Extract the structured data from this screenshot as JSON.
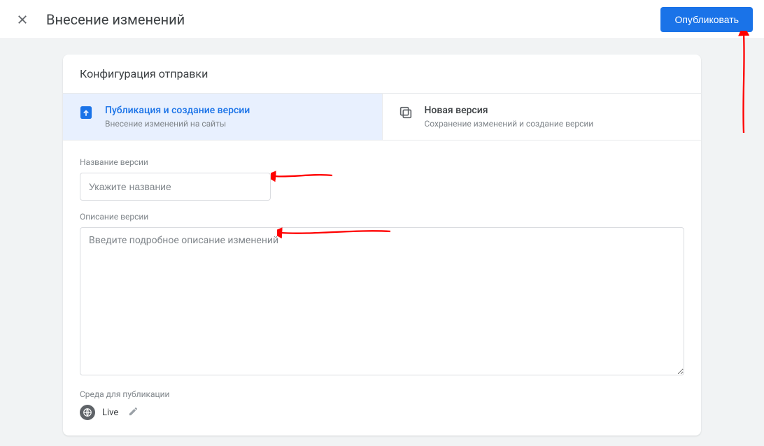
{
  "topbar": {
    "title": "Внесение изменений",
    "publish_label": "Опубликовать"
  },
  "card": {
    "header": "Конфигурация отправки",
    "options": [
      {
        "title": "Публикация и создание версии",
        "subtitle": "Внесение изменений на сайты",
        "selected": true,
        "icon": "upload-icon"
      },
      {
        "title": "Новая версия",
        "subtitle": "Сохранение изменений и создание версии",
        "selected": false,
        "icon": "copy-icon"
      }
    ],
    "version_name_label": "Название версии",
    "version_name_placeholder": "Укажите название",
    "version_desc_label": "Описание версии",
    "version_desc_placeholder": "Введите подробное описание изменений",
    "env_label": "Среда для публикации",
    "env_name": "Live"
  },
  "annotations": {
    "arrow_color": "#ff0000"
  }
}
